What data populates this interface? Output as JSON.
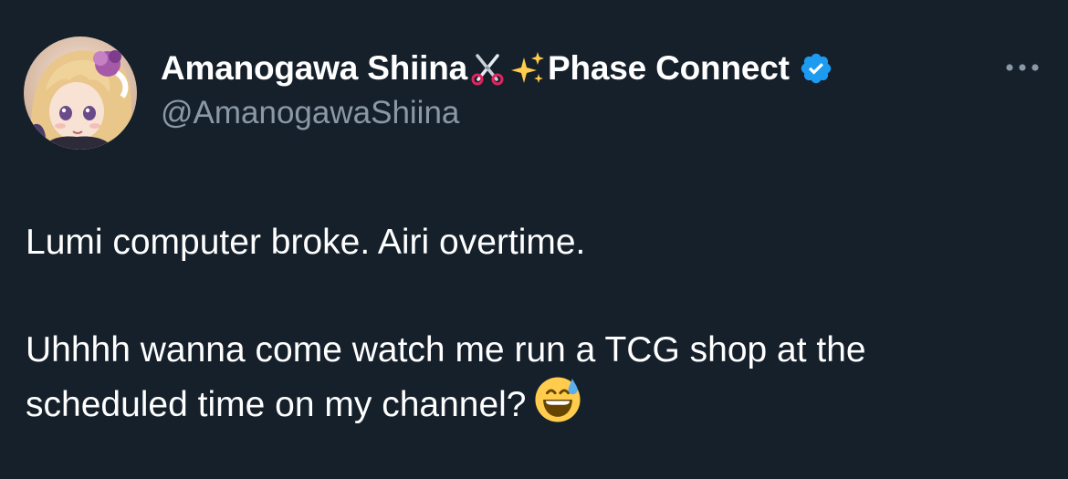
{
  "tweet": {
    "author": {
      "display_name": "Amanogawa Shiina",
      "name_suffix": "Phase Connect",
      "handle": "@AmanogawaShiina",
      "name_emojis": [
        "scissors-icon",
        "sparkles-icon"
      ],
      "verified": true,
      "verified_color": "#1d9bf0"
    },
    "more_label": "•••",
    "text_line_1": "Lumi computer broke. Airi overtime.",
    "text_line_2": "Uhhhh wanna come watch me run a TCG shop at the scheduled time on my channel?",
    "trailing_emoji": "grinning-face-with-sweat-icon"
  },
  "colors": {
    "background": "#15202b",
    "primary_text": "#ffffff",
    "secondary_text": "#8b98a5",
    "accent": "#1d9bf0"
  }
}
